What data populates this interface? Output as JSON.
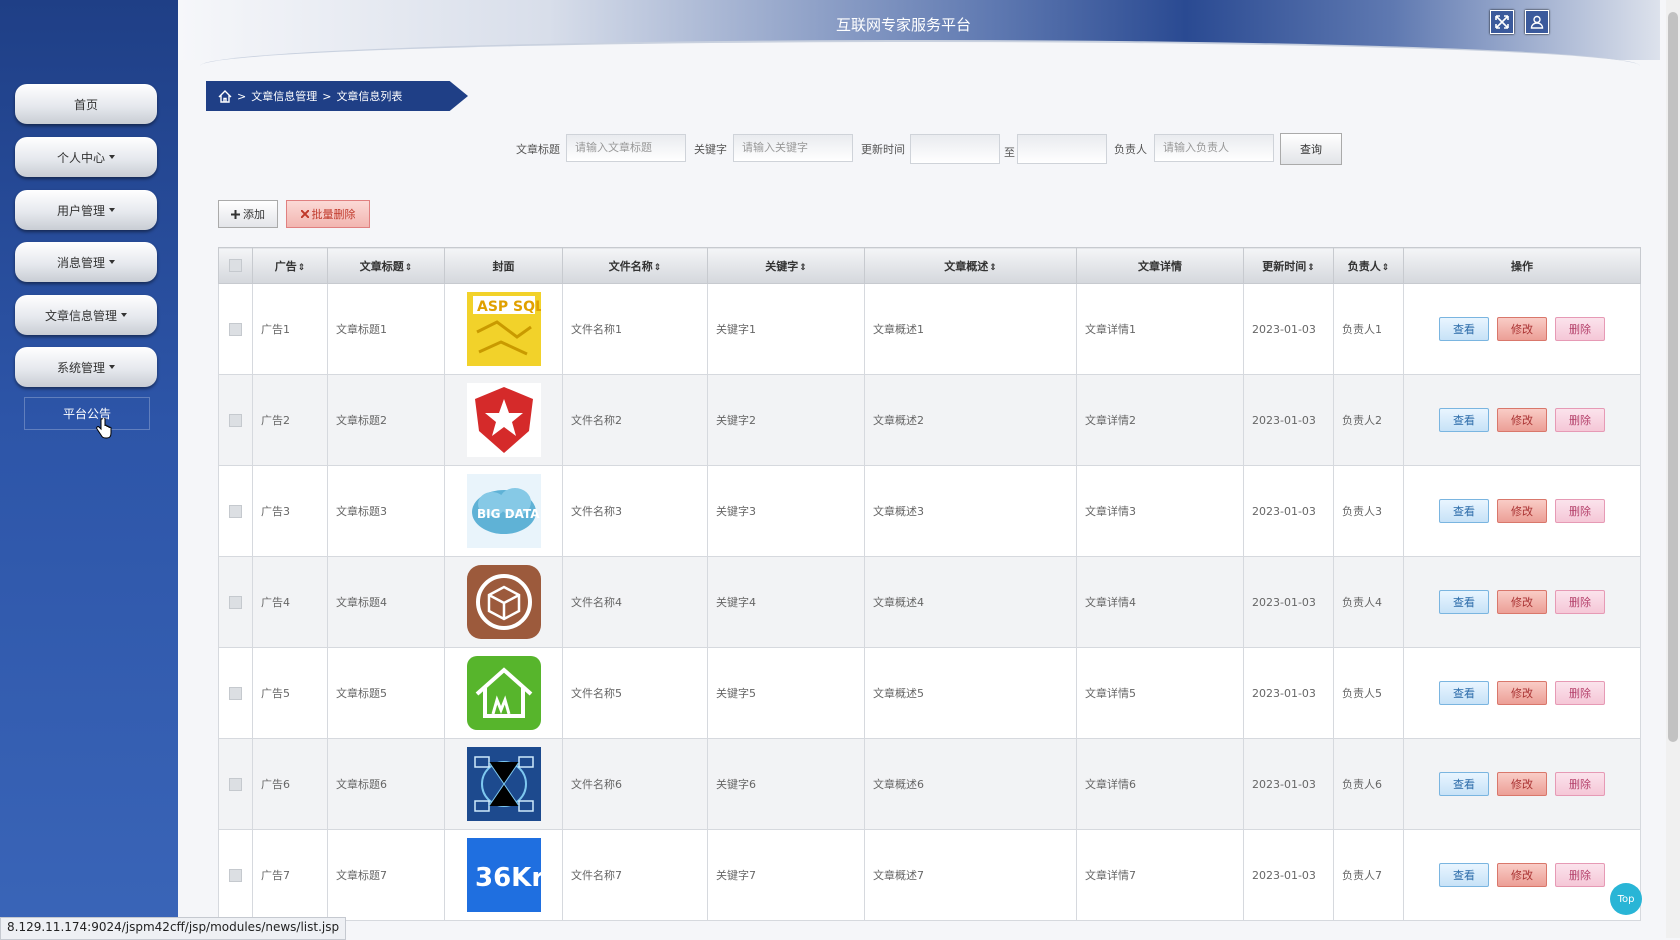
{
  "header": {
    "title": "互联网专家服务平台",
    "fullscreen_icon": "fullscreen-icon",
    "user_icon": "user-icon"
  },
  "sidebar": {
    "items": [
      {
        "label": "首页",
        "has_dropdown": false
      },
      {
        "label": "个人中心",
        "has_dropdown": true
      },
      {
        "label": "用户管理",
        "has_dropdown": true
      },
      {
        "label": "消息管理",
        "has_dropdown": true
      },
      {
        "label": "文章信息管理",
        "has_dropdown": true
      },
      {
        "label": "系统管理",
        "has_dropdown": true
      }
    ],
    "plain_item": "平台公告"
  },
  "breadcrumb": {
    "home_icon": "home-icon",
    "level1": "文章信息管理",
    "level2": "文章信息列表",
    "separator": ">"
  },
  "search": {
    "title_label": "文章标题",
    "title_placeholder": "请输入文章标题",
    "keyword_label": "关键字",
    "keyword_placeholder": "请输入关键字",
    "time_label": "更新时间",
    "time_to": "至",
    "owner_label": "负责人",
    "owner_placeholder": "请输入负责人",
    "query_label": "查询"
  },
  "toolbar": {
    "add_label": "添加",
    "batch_delete_label": "批量删除"
  },
  "table": {
    "headers": {
      "ad": "广告",
      "title": "文章标题",
      "cover": "封面",
      "filename": "文件名称",
      "keyword": "关键字",
      "summary": "文章概述",
      "detail": "文章详情",
      "updated": "更新时间",
      "owner": "负责人",
      "actions": "操作"
    },
    "sort_glyph": "⇕",
    "actions": {
      "view": "查看",
      "edit": "修改",
      "delete": "删除"
    },
    "rows": [
      {
        "ad": "广告1",
        "title": "文章标题1",
        "cover": "cover-asp-sql",
        "filename": "文件名称1",
        "keyword": "关键字1",
        "summary": "文章概述1",
        "detail": "文章详情1",
        "updated": "2023-01-03",
        "owner": "负责人1"
      },
      {
        "ad": "广告2",
        "title": "文章标题2",
        "cover": "cover-star-shield",
        "filename": "文件名称2",
        "keyword": "关键字2",
        "summary": "文章概述2",
        "detail": "文章详情2",
        "updated": "2023-01-03",
        "owner": "负责人2"
      },
      {
        "ad": "广告3",
        "title": "文章标题3",
        "cover": "cover-big-data",
        "filename": "文件名称3",
        "keyword": "关键字3",
        "summary": "文章概述3",
        "detail": "文章详情3",
        "updated": "2023-01-03",
        "owner": "负责人3"
      },
      {
        "ad": "广告4",
        "title": "文章标题4",
        "cover": "cover-package",
        "filename": "文件名称4",
        "keyword": "关键字4",
        "summary": "文章概述4",
        "detail": "文章详情4",
        "updated": "2023-01-03",
        "owner": "负责人4"
      },
      {
        "ad": "广告5",
        "title": "文章标题5",
        "cover": "cover-house",
        "filename": "文件名称5",
        "keyword": "关键字5",
        "summary": "文章概述5",
        "detail": "文章详情5",
        "updated": "2023-01-03",
        "owner": "负责人5"
      },
      {
        "ad": "广告6",
        "title": "文章标题6",
        "cover": "cover-network",
        "filename": "文件名称6",
        "keyword": "关键字6",
        "summary": "文章概述6",
        "detail": "文章详情6",
        "updated": "2023-01-03",
        "owner": "负责人6"
      },
      {
        "ad": "广告7",
        "title": "文章标题7",
        "cover": "cover-36kr",
        "filename": "文件名称7",
        "keyword": "关键字7",
        "summary": "文章概述7",
        "detail": "文章详情7",
        "updated": "2023-01-03",
        "owner": "负责人7"
      }
    ]
  },
  "status_bar": "8.129.11.174:9024/jspm42cff/jsp/modules/news/list.jsp",
  "top_button": "Top",
  "colors": {
    "sidebar": "#2d55a8",
    "breadcrumb": "#1f3f86",
    "top_button": "#29b5d6"
  }
}
